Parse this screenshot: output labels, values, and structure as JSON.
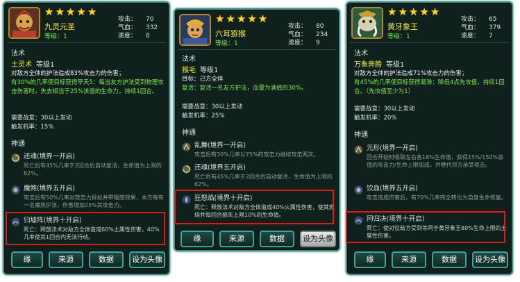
{
  "hero1": {
    "name": "九灵元圣",
    "level": "等级：1",
    "stats": [
      {
        "k": "攻击：",
        "v": "70"
      },
      {
        "k": "气血：",
        "v": "332"
      },
      {
        "k": "速度：",
        "v": "8"
      }
    ],
    "section_fashu": "法术",
    "skill_name": "土灵术",
    "skill_level": "等级1",
    "desc1": "对敌方全体的护法造成83%攻击力的伤害；",
    "desc2": "有30%的几率使目标获得早夭5：每当友方护法受到物理攻击伤害时，失去相当于25%该值的生命力，持续1回合。",
    "need": "需要战意：30以上发动",
    "trigger": "触发机率：15%",
    "section_shentong": "神通",
    "shentong": [
      {
        "title": "还魂(境界一开启)",
        "desc": "死亡后有45%几率于2回合后自动复活，生命值为上限的62%。"
      },
      {
        "title": "魔煞(境界五开启)",
        "desc": "攻击后有50%几率对攻击力目标并带锯感效果，本方每有一名魔族护法，伤害增加25%其攻击力。"
      },
      {
        "title": "归墟阵(境界十开启)",
        "desc": "死亡：释放法术对敌方全体造成60%土属性伤害，40%几率使其1回合内无法行动。"
      }
    ],
    "buttons": [
      "缘",
      "来源",
      "数据",
      "设为头像"
    ]
  },
  "hero2": {
    "name": "六耳猕猴",
    "level": "等级：1",
    "stats": [
      {
        "k": "攻击：",
        "v": "80"
      },
      {
        "k": "气血：",
        "v": "234"
      },
      {
        "k": "速度：",
        "v": "9"
      }
    ],
    "section_fashu": "法术",
    "skill_name": "猴毛",
    "skill_level": "等级1",
    "desc1": "目标：己方全体",
    "desc2": "复活：复活一名友方护法，血量为满值的30%。",
    "need": "需要战意：30以上发动",
    "trigger": "触发机率：25%",
    "section_shentong": "神通",
    "shentong": [
      {
        "title": "乱舞(境界一开启)",
        "desc": "攻击后有30%几率以75%的攻击力继续攻击两次。"
      },
      {
        "title": "还魂(境界五开启)",
        "desc": "死亡后有45%几率于2回合后自动复活，生命值为上限的62%。"
      },
      {
        "title": "狂怒焰(境界十开启)",
        "desc": "死亡：释放法术对敌方全体造成40%火属性伤害，使其燃烧并每回合损失上限10%的生命值。"
      }
    ],
    "buttons": [
      "缘",
      "来源",
      "数据",
      "设为头像"
    ]
  },
  "hero3": {
    "name": "黄牙象王",
    "level": "等级：1",
    "stats": [
      {
        "k": "攻击：",
        "v": "65"
      },
      {
        "k": "气血：",
        "v": "379"
      },
      {
        "k": "速度：",
        "v": "7"
      }
    ],
    "section_fashu": "法术",
    "skill_name": "万象奔腾",
    "skill_level": "等级1",
    "desc1": "对敌方全体的护法造成71%攻击力的伤害；",
    "desc2": "有45%的几率使目标获得凝滞：降低4点先攻值，持续1回合。（先攻值至少为1）",
    "need": "需要战意：30以上发动",
    "trigger": "触发机率：20%",
    "section_shentong": "神通",
    "shentong": [
      {
        "title": "元形(境界一开启)",
        "desc": "回合开始时吸取左右各18%生命值，获得15%/150%该值的攻击力/生命上限加成，并替代邻方承受攻击。"
      },
      {
        "title": "饮血(境界五开启)",
        "desc": "攻击造成伤害后，有70%几率完全转化为自身生命恢复。"
      },
      {
        "title": "同归决(境界十开启)",
        "desc": "死亡：使对位敌方受到等同于黄牙象王80%生命上限的土属性伤害。"
      }
    ],
    "buttons": [
      "缘",
      "来源",
      "数据",
      "设为头像"
    ]
  },
  "colors": {
    "panel_bg": "#10201c",
    "border": "#3e8c84",
    "star": "#ffd22a",
    "name": "#f2e64d",
    "green": "#7fe64f",
    "highlight_box": "#e01a1a"
  }
}
